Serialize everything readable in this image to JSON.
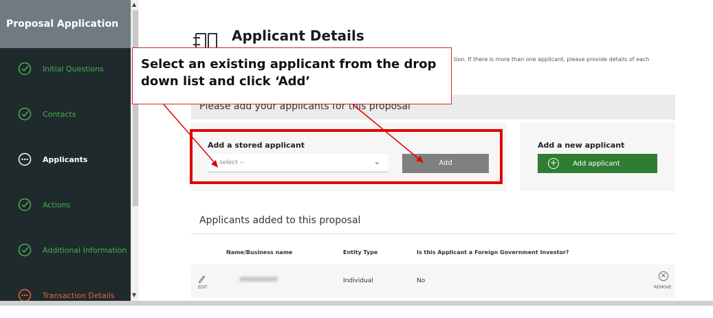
{
  "sidebar": {
    "title": "Proposal Application",
    "items": [
      {
        "label": "Initial Questions",
        "state": "done"
      },
      {
        "label": "Contacts",
        "state": "done"
      },
      {
        "label": "Applicants",
        "state": "active"
      },
      {
        "label": "Actions",
        "state": "done"
      },
      {
        "label": "Additional Information",
        "state": "done"
      },
      {
        "label": "Transaction Details",
        "state": "in-progress"
      }
    ]
  },
  "page": {
    "title": "Applicant Details",
    "intro_text": "tion. If there is more than one applicant, please provide details of each"
  },
  "callout": {
    "text": "Select an existing applicant from the drop down list and click ‘Add’"
  },
  "add_panel": {
    "heading": "Please add your applicants for this proposal",
    "stored_title": "Add a stored applicant",
    "select_value": "select --",
    "add_label": "Add",
    "new_title": "Add a new applicant",
    "new_button_label": "Add applicant"
  },
  "added": {
    "title": "Applicants added to this proposal",
    "columns": [
      "Name/Business name",
      "Entity Type",
      "Is this Applicant a Foreign Government Investor?"
    ],
    "rows": [
      {
        "entity_type": "Individual",
        "foreign_gov": "No",
        "edit_label": "EDIT",
        "remove_label": "REMOVE"
      }
    ]
  },
  "colors": {
    "sidebar_bg": "#1e2a2c",
    "done_green": "#4caf50",
    "warn_orange": "#e6673a",
    "add_btn_grey": "#808080",
    "primary_green": "#2f7d32",
    "annotation_red": "#e00000"
  },
  "icons": {
    "done": "check-circle-icon",
    "active": "dots-circle-icon",
    "in_progress": "dots-circle-icon",
    "page": "building-icon",
    "select": "chevron-down-icon",
    "new": "plus-circle-icon",
    "edit": "pencil-icon",
    "remove": "close-circle-icon"
  }
}
